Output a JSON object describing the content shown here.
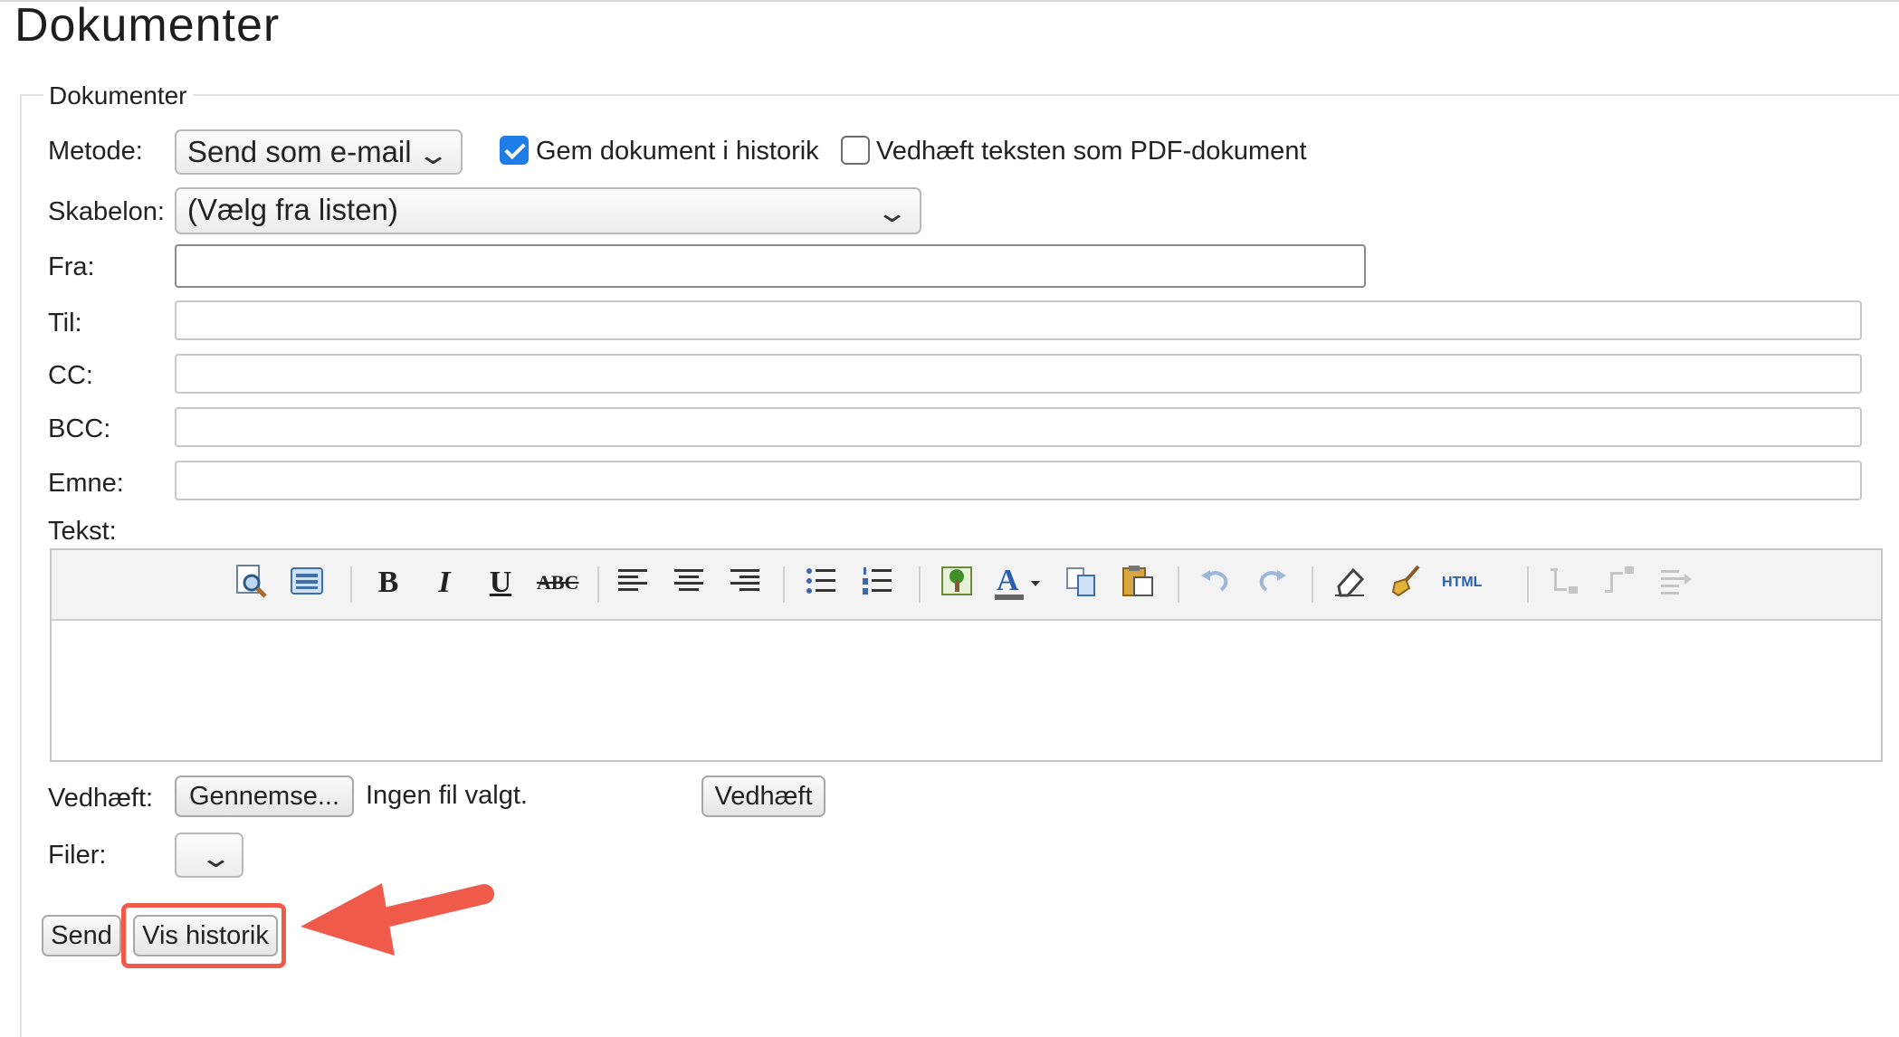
{
  "page": {
    "title": "Dokumenter"
  },
  "form": {
    "legend": "Dokumenter",
    "method": {
      "label": "Metode:",
      "selected": "Send som e-mail",
      "save_history": {
        "label": "Gem dokument i historik",
        "checked": true
      },
      "attach_pdf": {
        "label": "Vedhæft teksten som PDF-dokument",
        "checked": false
      }
    },
    "template": {
      "label": "Skabelon:",
      "selected": "(Vælg fra listen)"
    },
    "from": {
      "label": "Fra:",
      "value": ""
    },
    "to": {
      "label": "Til:",
      "value": ""
    },
    "cc": {
      "label": "CC:",
      "value": ""
    },
    "bcc": {
      "label": "BCC:",
      "value": ""
    },
    "subject": {
      "label": "Emne:",
      "value": ""
    },
    "text": {
      "label": "Tekst:",
      "value": ""
    },
    "attach": {
      "label": "Vedhæft:",
      "browse_button": "Gennemse...",
      "no_file": "Ingen fil valgt.",
      "attach_button": "Vedhæft"
    },
    "files": {
      "label": "Filer:",
      "selected": ""
    },
    "actions": {
      "send": "Send",
      "show_history": "Vis historik"
    }
  },
  "toolbar": {
    "items": [
      "preview-icon",
      "select-all-icon",
      "bold",
      "italic",
      "underline",
      "strikethrough",
      "align-left-icon",
      "align-center-icon",
      "align-right-icon",
      "bullet-list-icon",
      "numbered-list-icon",
      "insert-image-icon",
      "text-color-icon",
      "copy-icon",
      "paste-icon",
      "undo-icon",
      "redo-icon",
      "eraser-icon",
      "clean-format-icon",
      "html-source-icon",
      "indent-icon",
      "outdent-icon",
      "table-icon"
    ],
    "bold_glyph": "B",
    "italic_glyph": "I",
    "underline_glyph": "U",
    "strike_glyph": "ABC",
    "html_glyph": "HTML"
  },
  "colors": {
    "accent": "#1f7de8",
    "highlight": "#f05a4a"
  }
}
